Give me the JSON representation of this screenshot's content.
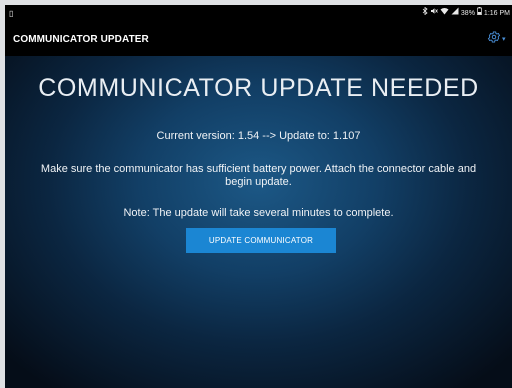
{
  "status_bar": {
    "notification_glyph": "▯",
    "bluetooth_icon": "bluetooth-icon",
    "battery_percent": "38%",
    "time": "1:16 PM"
  },
  "app_bar": {
    "title": "COMMUNICATOR UPDATER",
    "settings_icon": "gear-icon",
    "accent_color": "#4a90d9"
  },
  "main": {
    "headline": "COMMUNICATOR UPDATE NEEDED",
    "version_line": "Current version: 1.54 --> Update to: 1.107",
    "instructions": "Make sure the communicator has sufficient battery power. Attach the connector cable and begin update.",
    "note": "Note: The update will take several minutes to complete.",
    "update_button_label": "UPDATE COMMUNICATOR",
    "button_color": "#1b86d3"
  }
}
